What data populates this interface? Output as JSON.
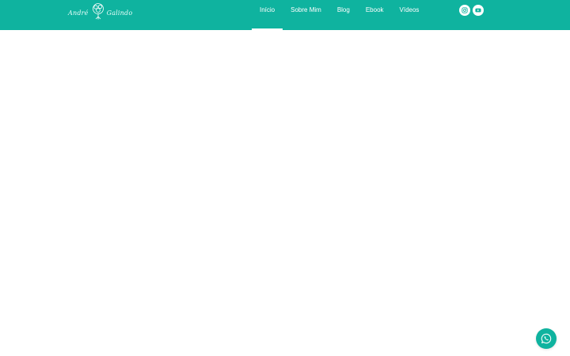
{
  "logo": {
    "first": "André",
    "last": "Galindo"
  },
  "nav": {
    "items": [
      {
        "label": "Início",
        "active": true
      },
      {
        "label": "Sobre Mim",
        "active": false
      },
      {
        "label": "Blog",
        "active": false
      },
      {
        "label": "Ebook",
        "active": false
      },
      {
        "label": "Vídeos",
        "active": false
      }
    ]
  },
  "socials": [
    "instagram-icon",
    "youtube-icon"
  ],
  "floating": {
    "icon": "whatsapp-icon"
  },
  "colors": {
    "header_bg": "#0fb39f",
    "nav_text": "#ffffff",
    "page_bg": "#ffffff"
  }
}
